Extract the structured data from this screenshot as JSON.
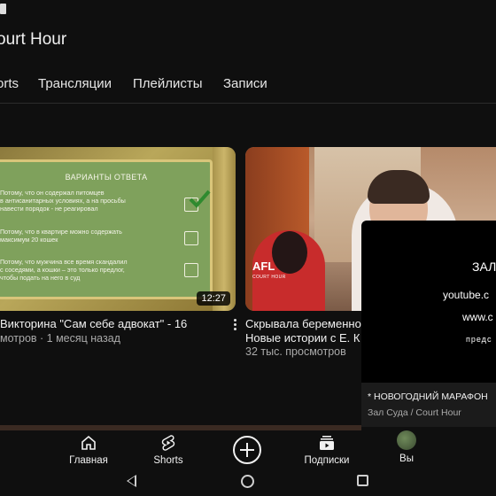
{
  "header": {
    "title": "ourt Hour"
  },
  "tabs": [
    {
      "label": "orts"
    },
    {
      "label": "Трансляции"
    },
    {
      "label": "Плейлисты"
    },
    {
      "label": "Записи"
    }
  ],
  "videos": [
    {
      "thumbnail": {
        "board_title": "ВАРИАНТЫ ОТВЕТА",
        "answers": [
          "Потому, что он содержал питомцев\nв антисанитарных условиях, а на просьбы\nнавести порядок - не реагировал",
          "Потому, что в квартире можно содержать\nмаксимум 20 кошек",
          "Потому, что мужчина все время скандалил\nс соседями, а кошки – это только предлог,\nчтобы подать на него в суд"
        ],
        "duration": "12:27"
      },
      "title": "Викторина \"Сам себе адвокат\" - 16",
      "meta": "мотров · 1 месяц назад"
    },
    {
      "thumbnail": {
        "logo": "AFL",
        "logo_sub": "COURT HOUR"
      },
      "title": "Скрывала беременно",
      "title_line2": "Новые истории с Е. К",
      "meta": "32 тыс. просмотров"
    }
  ],
  "popup": {
    "line1": "ЗАЛ",
    "line2": "youtube.c",
    "line3": "www.c",
    "line4": "предс",
    "title": "* НОВОГОДНИЙ МАРАФОН",
    "subtitle": "Зал Суда / Court Hour"
  },
  "bottom_nav": {
    "home": "Главная",
    "shorts": "Shorts",
    "subscriptions": "Подписки",
    "you": "Вы"
  },
  "colors": {
    "background": "#0f0f0f",
    "secondary_text": "#aaaaaa",
    "check": "#2f8a2f"
  }
}
